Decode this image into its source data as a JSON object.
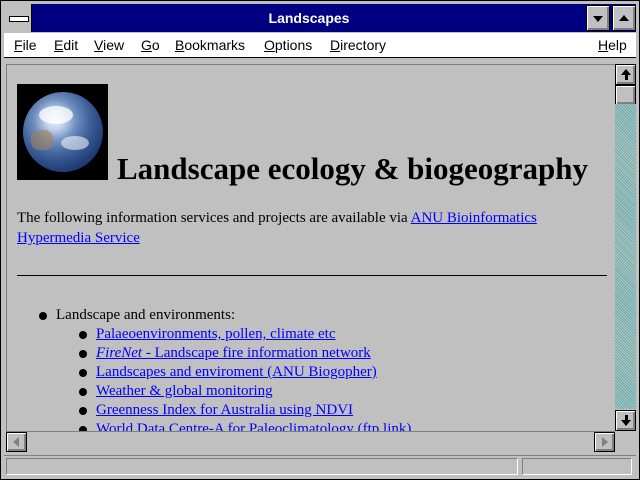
{
  "window": {
    "title": "Landscapes"
  },
  "menubar": {
    "items": [
      {
        "hotkey": "F",
        "rest": "ile"
      },
      {
        "hotkey": "E",
        "rest": "dit"
      },
      {
        "hotkey": "V",
        "rest": "iew"
      },
      {
        "hotkey": "G",
        "rest": "o"
      },
      {
        "hotkey": "B",
        "rest": "ookmarks"
      },
      {
        "hotkey": "O",
        "rest": "ptions"
      },
      {
        "hotkey": "D",
        "rest": "irectory"
      },
      {
        "hotkey": "H",
        "rest": "elp"
      }
    ]
  },
  "page": {
    "heading": "Landscape ecology & biogeography",
    "intro_text": "The following information services and projects are available via ",
    "intro_link": "ANU Bioinformatics Hypermedia Service",
    "list_heading": "Landscape and environments:",
    "links": [
      {
        "em": "",
        "text": "Palaeoenvironments, pollen, climate etc "
      },
      {
        "em": "FireNet",
        "text": " - Landscape fire information network"
      },
      {
        "em": "",
        "text": "Landscapes and enviroment (ANU Biogopher)"
      },
      {
        "em": "",
        "text": "Weather & global monitoring"
      },
      {
        "em": "",
        "text": "Greenness Index for Australia using NDVI"
      },
      {
        "em": "",
        "text": "World Data Centre-A for Paleoclimatology (ftp link)"
      }
    ]
  },
  "colors": {
    "titlebar": "#000080",
    "link": "#0000ff",
    "background": "#c0c0c0",
    "desktop": "#008080"
  },
  "icons": {
    "system_menu": "system-menu-icon",
    "minimize": "minimize-arrow-icon",
    "maximize": "maximize-arrow-icon",
    "image": "earth-globe-image"
  }
}
